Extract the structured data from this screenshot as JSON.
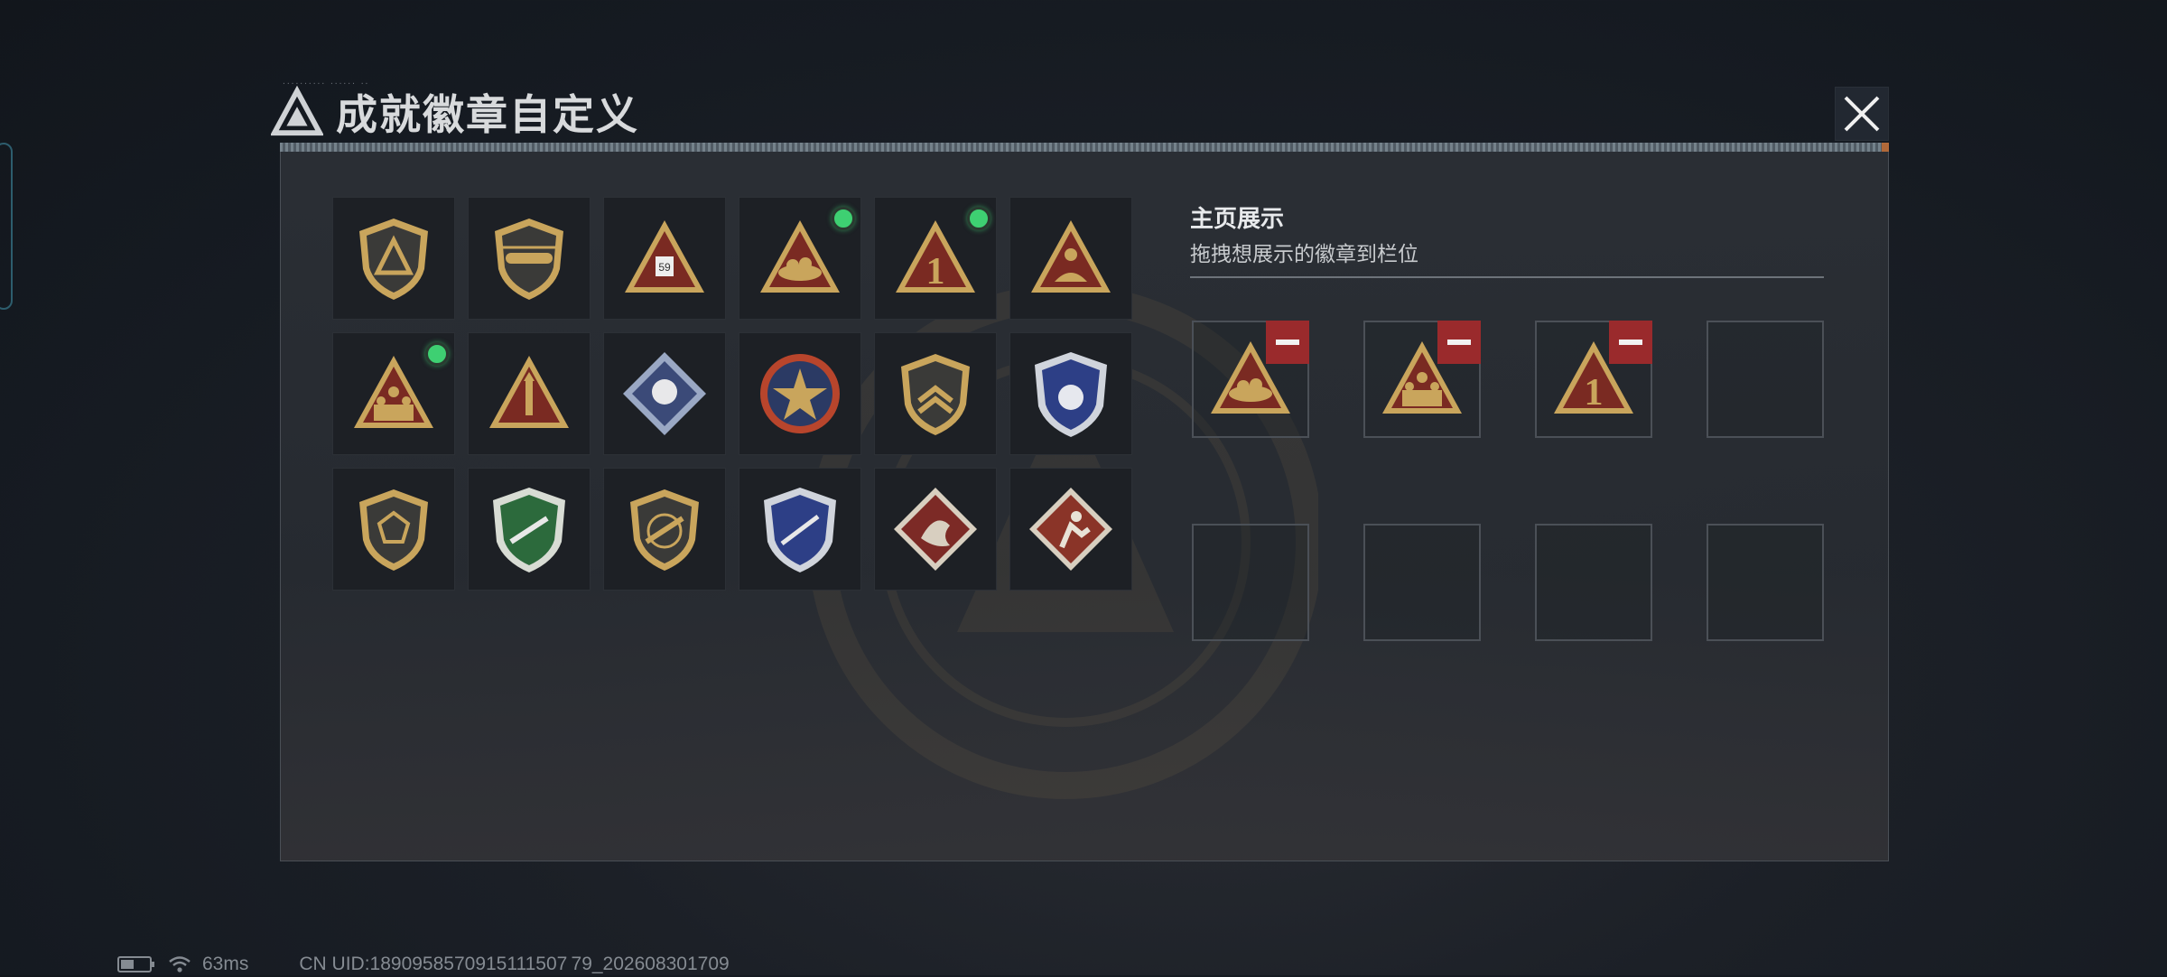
{
  "header": {
    "title": "成就徽章自定义",
    "tiny_text": "·········· ······ ··"
  },
  "showcase": {
    "title": "主页展示",
    "subtitle": "拖拽想展示的徽章到栏位"
  },
  "badges": [
    {
      "icon": "shield-triangle-emblem",
      "new": false
    },
    {
      "icon": "helicopter-shield-emblem",
      "new": false
    },
    {
      "icon": "soldier-59-triangle-badge",
      "new": false
    },
    {
      "icon": "nest-triangle-badge",
      "new": true
    },
    {
      "icon": "number-one-triangle-badge",
      "new": true
    },
    {
      "icon": "swimmer-triangle-badge",
      "new": false
    },
    {
      "icon": "squad-triangle-badge",
      "new": true
    },
    {
      "icon": "rocket-triangle-badge",
      "new": false
    },
    {
      "icon": "rose-diamond-badge",
      "new": false
    },
    {
      "icon": "star-medal-badge",
      "new": false
    },
    {
      "icon": "chevron-shield-emblem",
      "new": false
    },
    {
      "icon": "blue-wing-shield-badge",
      "new": false
    },
    {
      "icon": "dodecahedron-shield-emblem",
      "new": false
    },
    {
      "icon": "green-rifle-shield-badge",
      "new": false
    },
    {
      "icon": "rifle-shield-emblem",
      "new": false
    },
    {
      "icon": "blue-knife-shield-badge",
      "new": false
    },
    {
      "icon": "dragon-diamond-badge",
      "new": false
    },
    {
      "icon": "runner-diamond-badge",
      "new": false
    }
  ],
  "slots": [
    {
      "icon": "nest-triangle-badge",
      "filled": true
    },
    {
      "icon": "squad-triangle-badge",
      "filled": true
    },
    {
      "icon": "number-one-triangle-badge",
      "filled": true
    },
    {
      "icon": "",
      "filled": false
    },
    {
      "icon": "",
      "filled": false
    },
    {
      "icon": "",
      "filled": false
    },
    {
      "icon": "",
      "filled": false
    },
    {
      "icon": "",
      "filled": false
    }
  ],
  "status": {
    "ping": "63ms",
    "uid": "CN UID:1890958570915111507 79_202608301709"
  },
  "colors": {
    "gold": "#c9a55c",
    "new_dot": "#3ed072",
    "remove": "#9a2a2c",
    "badge_red": "#7a2a22"
  }
}
